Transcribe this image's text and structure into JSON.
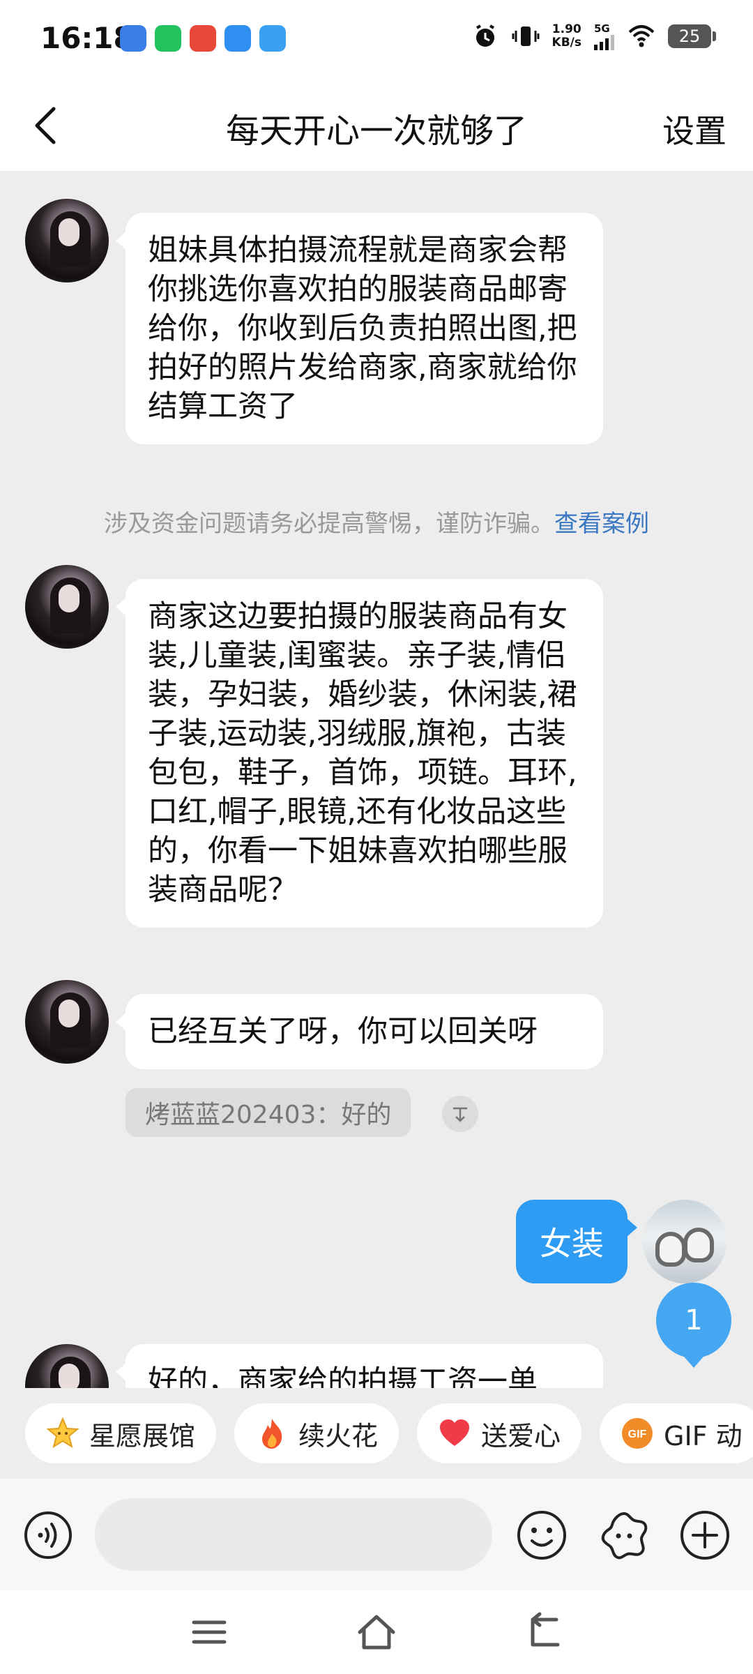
{
  "status_bar": {
    "time": "16:18",
    "net_speed_value": "1.90",
    "net_speed_unit": "KB/s",
    "signal_label": "5G",
    "battery": "25"
  },
  "header": {
    "title": "每天开心一次就够了",
    "settings_label": "设置"
  },
  "messages": [
    {
      "sender": "other",
      "text": "姐妹具体拍摄流程就是商家会帮你挑选你喜欢拍的服装商品邮寄给你，你收到后负责拍照出图,把拍好的照片发给商家,商家就给你结算工资了"
    },
    {
      "sender": "other",
      "text": "商家这边要拍摄的服装商品有女装,儿童装,闺蜜装。亲子装,情侣装，孕妇装，婚纱装，休闲装,裙子装,运动装,羽绒服,旗袍，古装包包，鞋子，首饰，项链。耳环,口红,帽子,眼镜,还有化妆品这些的，你看一下姐妹喜欢拍哪些服装商品呢？"
    },
    {
      "sender": "other",
      "text": "已经互关了呀，你可以回关呀"
    },
    {
      "sender": "me",
      "text": "女装"
    },
    {
      "sender": "other",
      "text": "好的，商家给的拍摄工资一单"
    }
  ],
  "notice": {
    "text": "涉及资金问题请务必提高警惕，谨防诈骗。",
    "link": "查看案例"
  },
  "quote": {
    "text": "烤蓝蓝202403：好的"
  },
  "unread_count": "1",
  "chips": [
    {
      "label": "星愿展馆",
      "icon": "star-icon"
    },
    {
      "label": "续火花",
      "icon": "fire-icon"
    },
    {
      "label": "送爱心",
      "icon": "heart-icon"
    },
    {
      "label": "GIF 动",
      "icon": "gif-icon"
    }
  ],
  "input": {
    "placeholder": ""
  },
  "colors": {
    "accent": "#2e9cf3",
    "link": "#3a78c3",
    "background": "#ededed"
  }
}
